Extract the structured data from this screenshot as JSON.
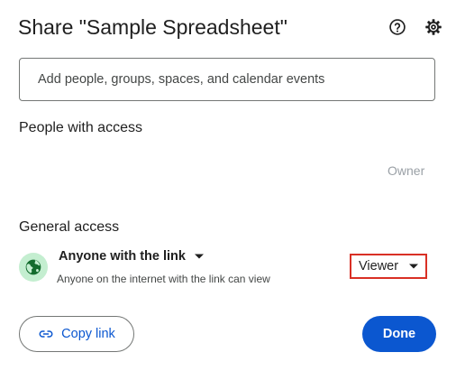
{
  "dialog": {
    "title": "Share \"Sample Spreadsheet\"",
    "help_icon": "help-circle-icon",
    "settings_icon": "gear-icon"
  },
  "add_people": {
    "placeholder": "Add people, groups, spaces, and calendar events",
    "value": ""
  },
  "people_with_access": {
    "heading": "People with access",
    "owner_label": "Owner"
  },
  "general_access": {
    "heading": "General access",
    "icon": "globe-icon",
    "access_level": "Anyone with the link",
    "description": "Anyone on the internet with the link can view",
    "role": "Viewer"
  },
  "actions": {
    "copy_link_label": "Copy link",
    "done_label": "Done"
  },
  "colors": {
    "accent": "#0b57d0",
    "globe_bg": "#c4eed0",
    "globe_fg": "#146c2e",
    "highlight_border": "#d93025"
  }
}
